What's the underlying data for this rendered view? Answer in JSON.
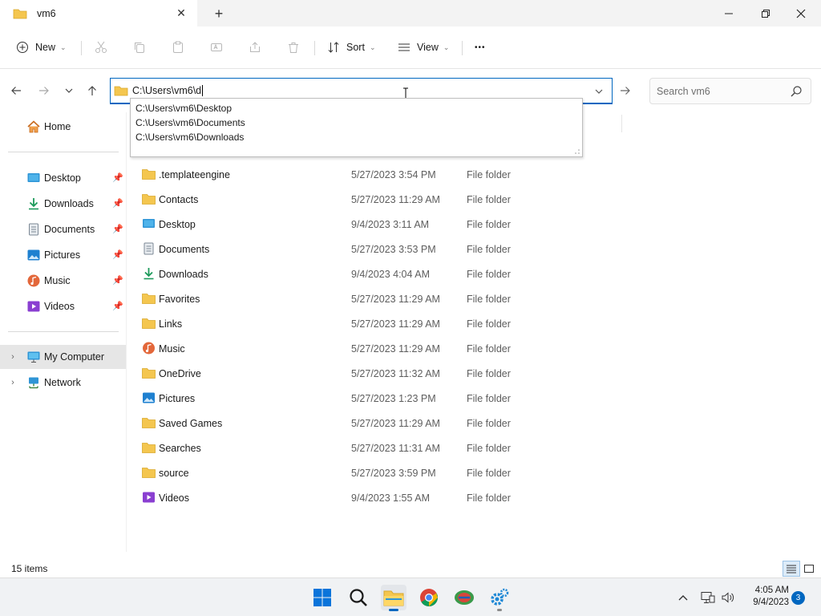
{
  "tab": {
    "title": "vm6",
    "close_icon": "close-icon"
  },
  "window": {
    "minimize": "minimize-icon",
    "maximize": "maximize-icon",
    "close": "close-icon"
  },
  "toolbar": {
    "new_label": "New",
    "sort_label": "Sort",
    "view_label": "View",
    "more_label": "•••"
  },
  "address": {
    "value": "C:\\Users\\vm6\\d"
  },
  "search": {
    "placeholder": "Search vm6"
  },
  "autocomplete": [
    "C:\\Users\\vm6\\Desktop",
    "C:\\Users\\vm6\\Documents",
    "C:\\Users\\vm6\\Downloads"
  ],
  "sidebar": {
    "home": "Home",
    "quick": [
      {
        "label": "Desktop",
        "icon": "desktop-icon"
      },
      {
        "label": "Downloads",
        "icon": "downloads-icon"
      },
      {
        "label": "Documents",
        "icon": "documents-icon"
      },
      {
        "label": "Pictures",
        "icon": "pictures-icon"
      },
      {
        "label": "Music",
        "icon": "music-icon"
      },
      {
        "label": "Videos",
        "icon": "videos-icon"
      }
    ],
    "my_computer": "My Computer",
    "network": "Network"
  },
  "files": [
    {
      "name": ".templateengine",
      "date": "5/27/2023 3:54 PM",
      "type": "File folder",
      "icon": "folder-icon"
    },
    {
      "name": "Contacts",
      "date": "5/27/2023 11:29 AM",
      "type": "File folder",
      "icon": "folder-icon"
    },
    {
      "name": "Desktop",
      "date": "9/4/2023 3:11 AM",
      "type": "File folder",
      "icon": "desktop-icon"
    },
    {
      "name": "Documents",
      "date": "5/27/2023 3:53 PM",
      "type": "File folder",
      "icon": "documents-icon"
    },
    {
      "name": "Downloads",
      "date": "9/4/2023 4:04 AM",
      "type": "File folder",
      "icon": "downloads-icon"
    },
    {
      "name": "Favorites",
      "date": "5/27/2023 11:29 AM",
      "type": "File folder",
      "icon": "folder-icon"
    },
    {
      "name": "Links",
      "date": "5/27/2023 11:29 AM",
      "type": "File folder",
      "icon": "folder-icon"
    },
    {
      "name": "Music",
      "date": "5/27/2023 11:29 AM",
      "type": "File folder",
      "icon": "music-icon"
    },
    {
      "name": "OneDrive",
      "date": "5/27/2023 11:32 AM",
      "type": "File folder",
      "icon": "folder-icon"
    },
    {
      "name": "Pictures",
      "date": "5/27/2023 1:23 PM",
      "type": "File folder",
      "icon": "pictures-icon"
    },
    {
      "name": "Saved Games",
      "date": "5/27/2023 11:29 AM",
      "type": "File folder",
      "icon": "folder-icon"
    },
    {
      "name": "Searches",
      "date": "5/27/2023 11:31 AM",
      "type": "File folder",
      "icon": "folder-icon"
    },
    {
      "name": "source",
      "date": "5/27/2023 3:59 PM",
      "type": "File folder",
      "icon": "folder-icon"
    },
    {
      "name": "Videos",
      "date": "9/4/2023 1:55 AM",
      "type": "File folder",
      "icon": "videos-icon"
    }
  ],
  "status": {
    "count": "15 items"
  },
  "taskbar": {
    "apps": [
      "start-icon",
      "search-icon",
      "file-explorer-icon",
      "chrome-icon",
      "app-icon",
      "settings-icon"
    ],
    "time": "4:05 AM",
    "date": "9/4/2023",
    "notifications": "3"
  },
  "colors": {
    "accent": "#0067c0",
    "folder": "#f4c64f"
  }
}
